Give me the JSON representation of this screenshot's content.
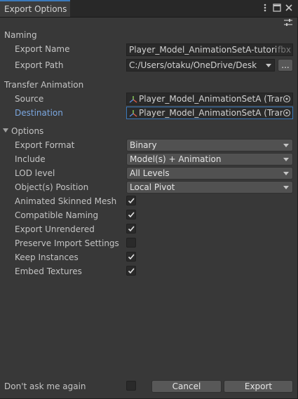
{
  "window": {
    "tab_title": "Export Options",
    "menu_icon": "kebab-menu-icon",
    "maximize_icon": "maximize-icon",
    "close_icon": "close-icon",
    "settings_icon": "settings-sliders-icon"
  },
  "naming": {
    "header": "Naming",
    "export_name_label": "Export Name",
    "export_name_value": "Player_Model_AnimationSetA-tutorial",
    "export_name_suffix": "fbx",
    "export_path_label": "Export Path",
    "export_path_value": "C:/Users/otaku/OneDrive/Desk",
    "browse_button": "..."
  },
  "transfer": {
    "header": "Transfer Animation",
    "source_label": "Source",
    "source_value": "Player_Model_AnimationSetA (Trans",
    "destination_label": "Destination",
    "destination_value": "Player_Model_AnimationSetA (Trans"
  },
  "options": {
    "header": "Options",
    "export_format_label": "Export Format",
    "export_format_value": "Binary",
    "include_label": "Include",
    "include_value": "Model(s) + Animation",
    "lod_label": "LOD level",
    "lod_value": "All Levels",
    "position_label": "Object(s) Position",
    "position_value": "Local Pivot",
    "checkboxes": [
      {
        "label": "Animated Skinned Mesh",
        "checked": true
      },
      {
        "label": "Compatible Naming",
        "checked": true
      },
      {
        "label": "Export Unrendered",
        "checked": true
      },
      {
        "label": "Preserve Import Settings",
        "checked": false
      },
      {
        "label": "Keep Instances",
        "checked": true
      },
      {
        "label": "Embed Textures",
        "checked": true
      }
    ]
  },
  "footer": {
    "dont_ask_label": "Don't ask me again",
    "dont_ask_checked": false,
    "cancel_button": "Cancel",
    "export_button": "Export"
  },
  "colors": {
    "background": "#383838",
    "titlebar": "#282828",
    "accent": "#3a79bb",
    "active_label": "#7ba7e0",
    "field_bg": "#2a2a2a",
    "button_bg": "#585858"
  }
}
